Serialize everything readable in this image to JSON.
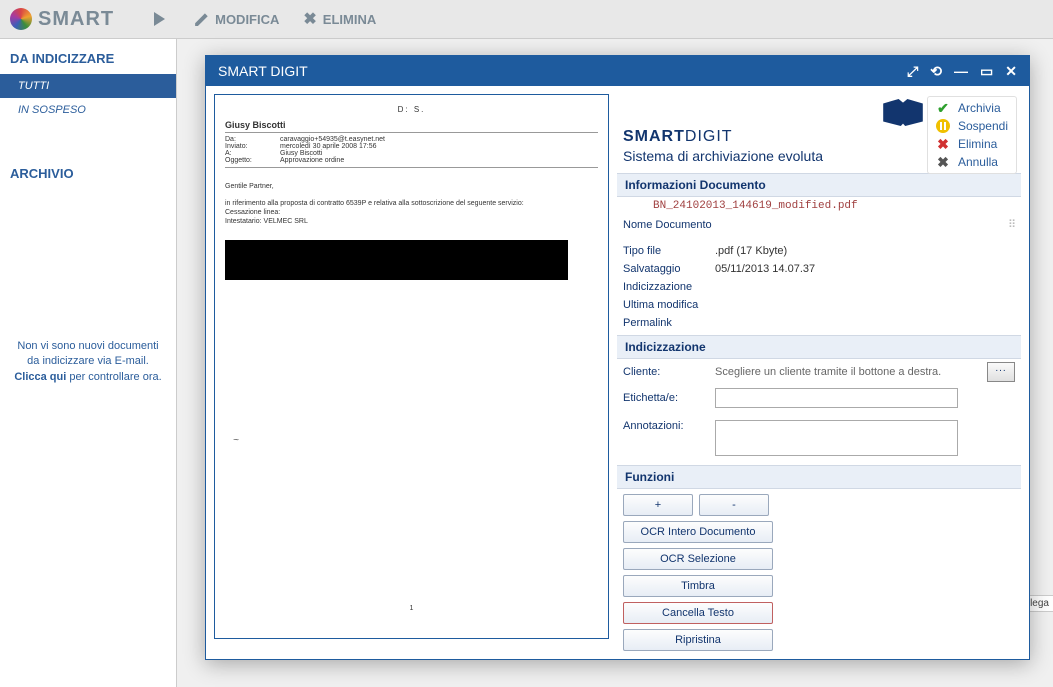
{
  "header": {
    "logo_text": "SMART",
    "btn_modifica": "MODIFICA",
    "btn_elimina": "ELIMINA"
  },
  "sidebar": {
    "section1_title": "DA INDICIZZARE",
    "item_tutti": "TUTTI",
    "item_sospeso": "IN SOSPESO",
    "section2_title": "ARCHIVIO",
    "note_part1": "Non vi sono nuovi documenti da indicizzare via E-mail. ",
    "note_link": "Clicca qui",
    "note_part2": " per controllare ora."
  },
  "dialog": {
    "title": "SMART DIGIT",
    "brand_a": "SMART",
    "brand_b": "DIGIT",
    "subtitle": "Sistema di archiviazione evoluta",
    "actions": {
      "archivia": "Archivia",
      "sospendi": "Sospendi",
      "elimina": "Elimina",
      "annulla": "Annulla"
    },
    "sec_info": "Informazioni Documento",
    "doc_filename": "BN_24102013_144619_modified.pdf",
    "rows": {
      "nome_doc_label": "Nome Documento",
      "tipo_file_label": "Tipo file",
      "tipo_file_value": ".pdf (17 Kbyte)",
      "salvataggio_label": "Salvataggio",
      "salvataggio_value": "05/11/2013 14.07.37",
      "indicizz_label": "Indicizzazione",
      "ultima_mod_label": "Ultima modifica",
      "permalink_label": "Permalink"
    },
    "sec_indic": "Indicizzazione",
    "cliente_label": "Cliente:",
    "cliente_hint": "Scegliere un cliente tramite il bottone a destra.",
    "ellipsis": "...",
    "etichetta_label": "Etichetta/e:",
    "annot_label": "Annotazioni:",
    "sec_funz": "Funzioni",
    "funz": {
      "plus": "+",
      "minus": "-",
      "ocr_doc": "OCR Intero Documento",
      "ocr_sel": "OCR Selezione",
      "timbra": "Timbra",
      "cancella": "Cancella Testo",
      "ripristina": "Ripristina"
    }
  },
  "preview": {
    "top_seq": "D: S.",
    "name": "Giusy Biscotti",
    "da_label": "Da:",
    "da_value": "caravaggio+54935@t.easynet.net",
    "inviato_label": "Inviato:",
    "inviato_value": "mercoledì 30 aprile 2008 17:56",
    "a_label": "A:",
    "a_value": "Giusy Biscotti",
    "oggetto_label": "Oggetto:",
    "oggetto_value": "Approvazione ordine",
    "body_salute": "Gentile Partner,",
    "body_line1": "in riferimento alla proposta di contratto 6539P e relativa alla sottoscrizione del seguente servizio:",
    "body_line2": "Cessazione linea:",
    "body_line3": "Intestatario: VELMEC SRL",
    "sig": "~",
    "pagenum": "1"
  },
  "bg_tab": "Allega"
}
